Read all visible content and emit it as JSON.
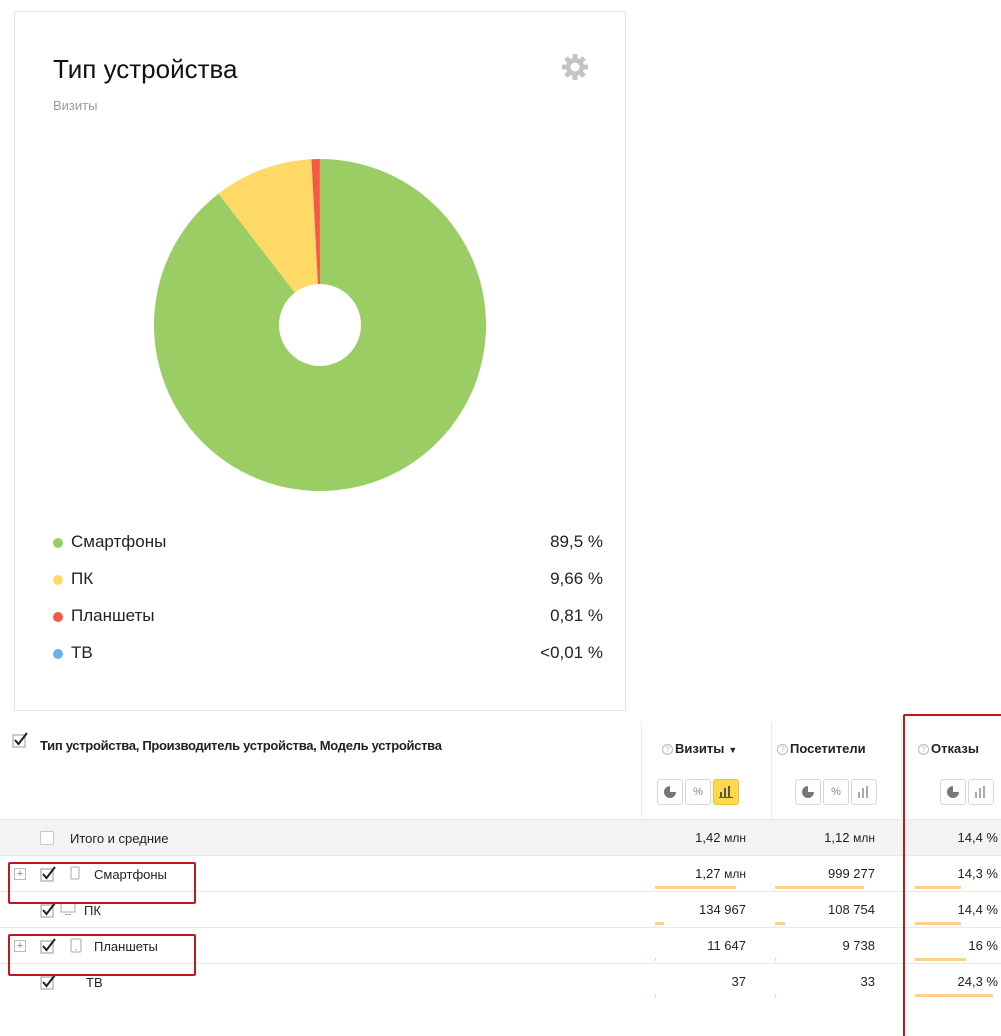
{
  "widget": {
    "title": "Тип устройства",
    "subtitle": "Визиты",
    "settings_icon": "gear-icon"
  },
  "chart_data": {
    "type": "pie",
    "title": "Тип устройства",
    "subtitle": "Визиты",
    "slices": [
      {
        "name": "Смартфоны",
        "value": 89.5,
        "label": "89,5 %",
        "color": "#9acd63"
      },
      {
        "name": "ПК",
        "value": 9.66,
        "label": "9,66 %",
        "color": "#ffd966"
      },
      {
        "name": "Планшеты",
        "value": 0.81,
        "label": "0,81 %",
        "color": "#f65a45"
      },
      {
        "name": "ТВ",
        "value": 0.01,
        "label": "<0,01 %",
        "color": "#6faee8"
      }
    ],
    "donut": true,
    "legend": "bottom"
  },
  "table": {
    "dimensions_title": "Тип устройства, Производитель устройства, Модель устройства",
    "columns": [
      {
        "label": "Визиты",
        "sorted": "▼"
      },
      {
        "label": "Посетители"
      },
      {
        "label": "Отказы"
      }
    ],
    "help_icon": "?",
    "view_buttons": [
      "pie-icon",
      "percent-icon",
      "bar-icon"
    ],
    "totals": {
      "label": "Итого и средние",
      "visits": "1,42",
      "visits_unit": "млн",
      "visitors": "1,12",
      "visitors_unit": "млн",
      "bounce": "14,4 %"
    },
    "rows": [
      {
        "label": "Смартфоны",
        "icon": "smartphone-icon",
        "expandable": true,
        "visits": "1,27",
        "visits_unit": "млн",
        "visitors": "999 277",
        "bounce": "14,3 %",
        "visits_share": 0.895,
        "visitors_share": 0.892,
        "bounce_share": 0.57
      },
      {
        "label": "ПК",
        "icon": "desktop-icon",
        "expandable": false,
        "visits": "134 967",
        "visits_unit": "",
        "visitors": "108 754",
        "bounce": "14,4 %",
        "visits_share": 0.095,
        "visitors_share": 0.097,
        "bounce_share": 0.58
      },
      {
        "label": "Планшеты",
        "icon": "tablet-icon",
        "expandable": true,
        "visits": "11 647",
        "visits_unit": "",
        "visitors": "9 738",
        "bounce": "16 %",
        "visits_share": 0.008,
        "visitors_share": 0.009,
        "bounce_share": 0.64
      },
      {
        "label": "ТВ",
        "icon": "tv-icon",
        "expandable": false,
        "visits": "37",
        "visits_unit": "",
        "visitors": "33",
        "bounce": "24,3 %",
        "visits_share": 0.0003,
        "visitors_share": 0.0003,
        "bounce_share": 0.97
      }
    ]
  },
  "highlights": {
    "color": "#c0181c"
  }
}
